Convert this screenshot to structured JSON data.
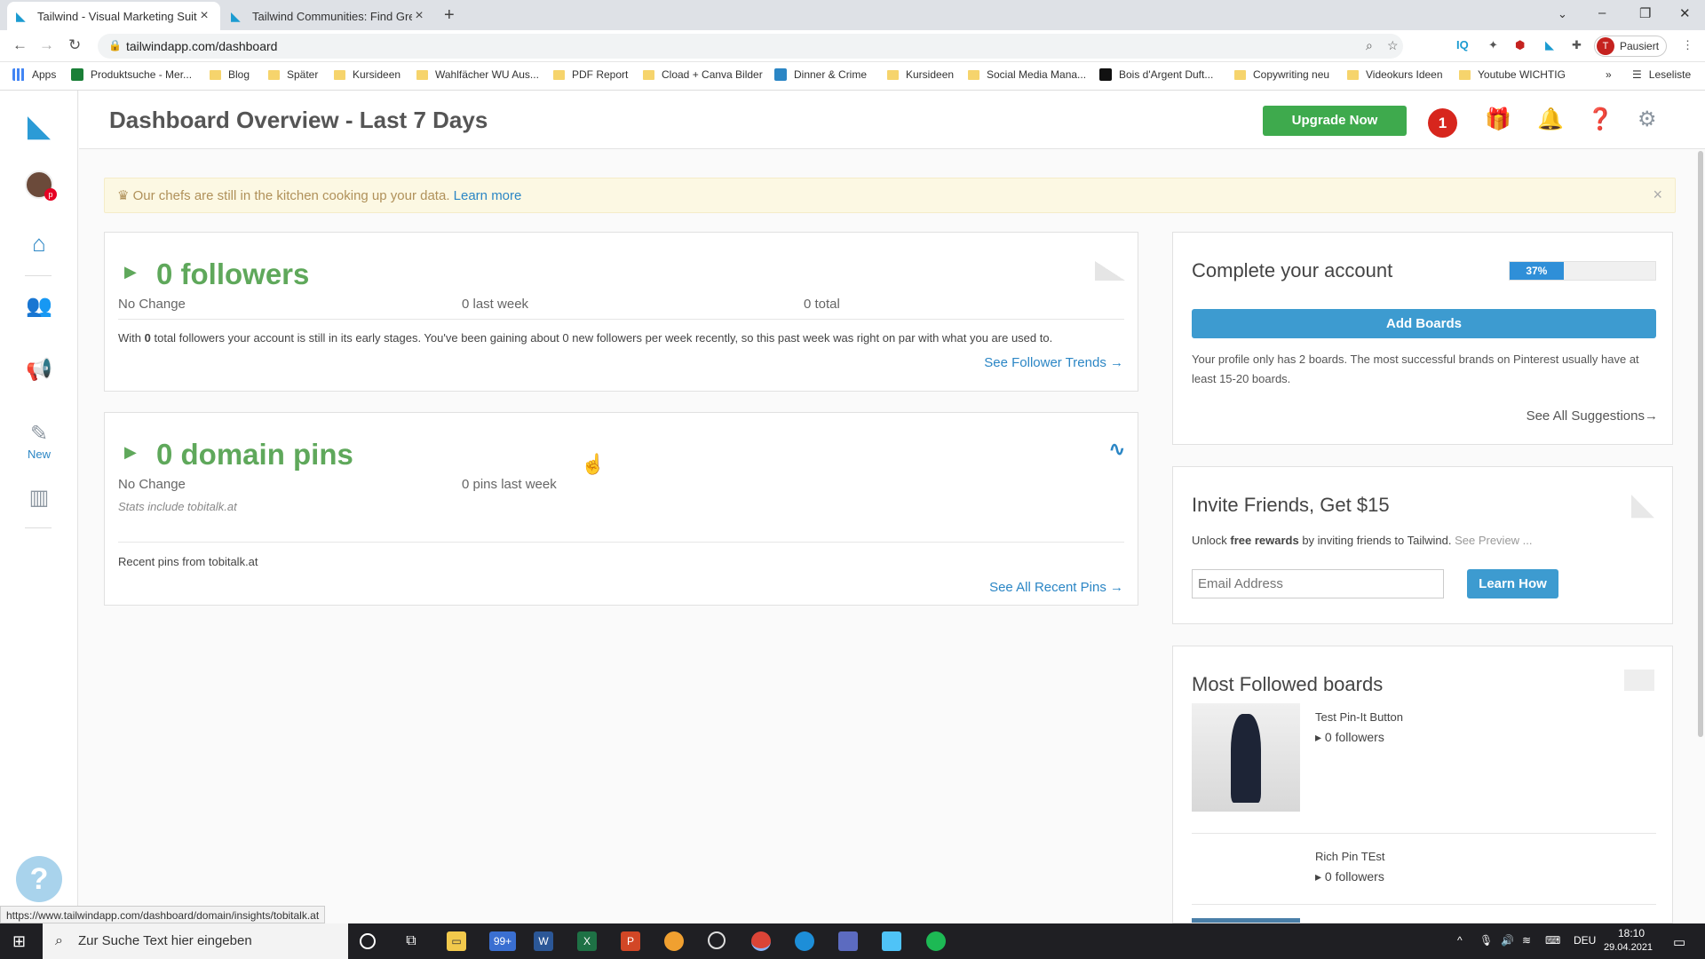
{
  "browser": {
    "tabs": [
      {
        "label": "Tailwind - Visual Marketing Suite"
      },
      {
        "label": "Tailwind Communities: Find Grea"
      }
    ],
    "url": "tailwindapp.com/dashboard",
    "profile_initial": "T",
    "profile_label": "Pausiert",
    "bookmarks": [
      "Apps",
      "Produktsuche - Mer...",
      "Blog",
      "Später",
      "Kursideen",
      "Wahlfächer WU Aus...",
      "PDF Report",
      "Cload + Canva Bilder",
      "Dinner & Crime",
      "Kursideen",
      "Social Media Mana...",
      "Bois d'Argent Duft...",
      "Copywriting neu",
      "Videokurs Ideen",
      "Youtube WICHTIG"
    ],
    "reading_list": "Leseliste",
    "status_url": "https://www.tailwindapp.com/dashboard/domain/insights/tobitalk.at"
  },
  "sidebar": {
    "new_label": "New"
  },
  "header": {
    "title": "Dashboard Overview - Last 7 Days",
    "upgrade_label": "Upgrade Now",
    "notification_count": "1"
  },
  "banner": {
    "text": "Our chefs are still in the kitchen cooking up your data.",
    "link": "Learn more"
  },
  "followers_card": {
    "metric": "0 followers",
    "change": "No Change",
    "last_week": "0 last week",
    "total": "0 total",
    "desc_prefix": "With",
    "desc_count": "0",
    "desc_rest": "total followers your account is still in its early stages. You've been gaining about 0 new followers per week recently, so this past week was right on par with what you are used to.",
    "link": "See Follower Trends →"
  },
  "pins_card": {
    "metric": "0 domain pins",
    "change": "No Change",
    "last_week": "0 pins last week",
    "note": "Stats include tobitalk.at",
    "recent_label": "Recent pins from tobitalk.at",
    "link": "See All Recent Pins →"
  },
  "account_card": {
    "title": "Complete your account",
    "progress_label": "37%",
    "progress_value": 37,
    "button": "Add Boards",
    "desc": "Your profile only has 2 boards. The most successful brands on Pinterest usually have at least 15-20 boards.",
    "link": "See All Suggestions→"
  },
  "invite_card": {
    "title": "Invite Friends, Get $15",
    "desc_prefix": "Unlock",
    "desc_bold": "free rewards",
    "desc_rest": "by inviting friends to Tailwind.",
    "preview_link": "See Preview ...",
    "email_placeholder": "Email Address",
    "button": "Learn How"
  },
  "boards_card": {
    "title": "Most Followed boards",
    "boards": [
      {
        "name": "Test Pin-It Button",
        "followers": "0 followers"
      },
      {
        "name": "Rich Pin TEst",
        "followers": "0 followers"
      }
    ]
  },
  "taskbar": {
    "search_placeholder": "Zur Suche Text hier eingeben",
    "mail_badge": "99+",
    "language": "DEU",
    "time": "18:10",
    "date": "29.04.2021"
  }
}
